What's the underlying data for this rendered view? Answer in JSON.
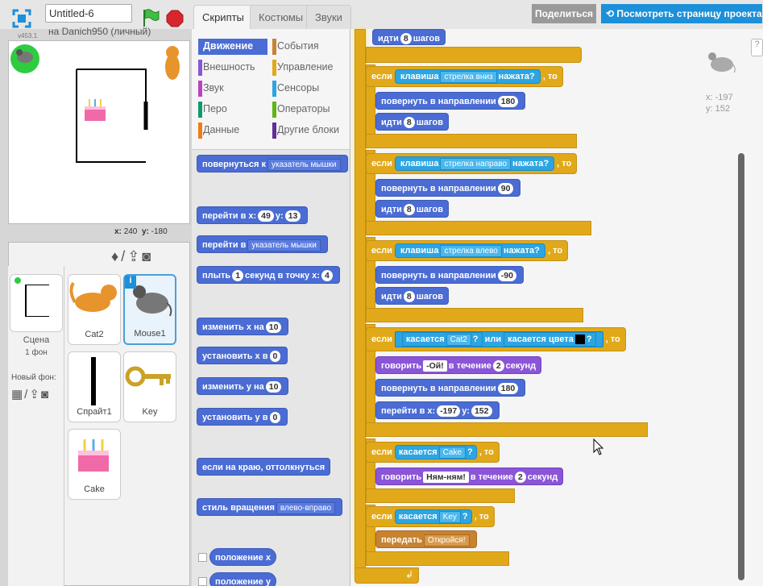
{
  "project": {
    "name": "Untitled-6",
    "owner": "на Danich950 (личный)",
    "version": "v453.1"
  },
  "colors": {
    "motion": "#4a6cd4",
    "control": "#e1a91a",
    "sensing": "#2ca5e2",
    "looks": "#8a55d7",
    "events": "#c88330",
    "share": "#999999",
    "view_project": "#1c90d8"
  },
  "stage": {
    "coords_x_label": "x:",
    "coords_x": "240",
    "coords_y_label": "y:",
    "coords_y": "-180"
  },
  "header": {
    "share": "Поделиться",
    "view_project": "Посмотреть страницу проекта"
  },
  "tabs": [
    "Скрипты",
    "Костюмы",
    "Звуки"
  ],
  "categories": [
    {
      "label": "Движение",
      "color": "#4a6cd4"
    },
    {
      "label": "События",
      "color": "#c88330"
    },
    {
      "label": "Внешность",
      "color": "#8a55d7"
    },
    {
      "label": "Управление",
      "color": "#e1a91a"
    },
    {
      "label": "Звук",
      "color": "#bb42c3"
    },
    {
      "label": "Сенсоры",
      "color": "#2ca5e2"
    },
    {
      "label": "Перо",
      "color": "#0e9a6c"
    },
    {
      "label": "Операторы",
      "color": "#5cb712"
    },
    {
      "label": "Данные",
      "color": "#ee7d16"
    },
    {
      "label": "Другие блоки",
      "color": "#632d99"
    }
  ],
  "sprites": {
    "scene_label": "Сцена",
    "scene_sub": "1 фон",
    "new_backdrop": "Новый фон:",
    "items": [
      "Cat2",
      "Mouse1",
      "Спрайт1",
      "Key",
      "Cake"
    ]
  },
  "palette": {
    "turn_towards": "повернуться к",
    "turn_towards_dd": "указатель мышки",
    "goto_xy": "перейти в x:",
    "goto_x": "49",
    "y_label": "y:",
    "goto_y": "13",
    "goto": "перейти в",
    "goto_dd": "указатель мышки",
    "glide": "плыть",
    "glide_secs": "1",
    "glide_rest": "секунд в точку x:",
    "glide_x": "4",
    "change_x": "изменить х на",
    "change_x_val": "10",
    "set_x": "установить х в",
    "set_x_val": "0",
    "change_y": "изменить у на",
    "change_y_val": "10",
    "set_y": "установить у в",
    "set_y_val": "0",
    "bounce": "если на краю, оттолкнуться",
    "rotation": "стиль вращения",
    "rotation_dd": "влево-вправо",
    "pos_x": "положение x",
    "pos_y": "положение y"
  },
  "script": {
    "move_top": "идти",
    "move_top_val": "8",
    "steps": "шагов",
    "if": "если",
    "then": ", то",
    "key": "клавиша",
    "pressed": "нажата?",
    "key_down": "стрелка вниз",
    "key_right": "стрелка направо",
    "key_left": "стрелка влево",
    "point_dir": "повернуть в направлении",
    "dir_down": "180",
    "dir_right": "90",
    "dir_left": "-90",
    "move": "идти",
    "move_val": "8",
    "touching": "касается",
    "cat2": "Cat2",
    "q": "?",
    "or": "или",
    "touching_color": "касается цвета",
    "say": "говорить",
    "say_oi": "-Ой!",
    "for": "в течение",
    "secs_val": "2",
    "seconds": "секунд",
    "dir_back": "180",
    "goto_xy": "перейти в x:",
    "x_val": "-197",
    "y_lbl": "y:",
    "y_val": "152",
    "cake": "Cake",
    "say_yum": "Ням-ням!",
    "key_sprite": "Key",
    "broadcast": "передать",
    "broadcast_msg": "Откройся!"
  },
  "readout": {
    "x": "x: -197",
    "y": "y: 152"
  }
}
